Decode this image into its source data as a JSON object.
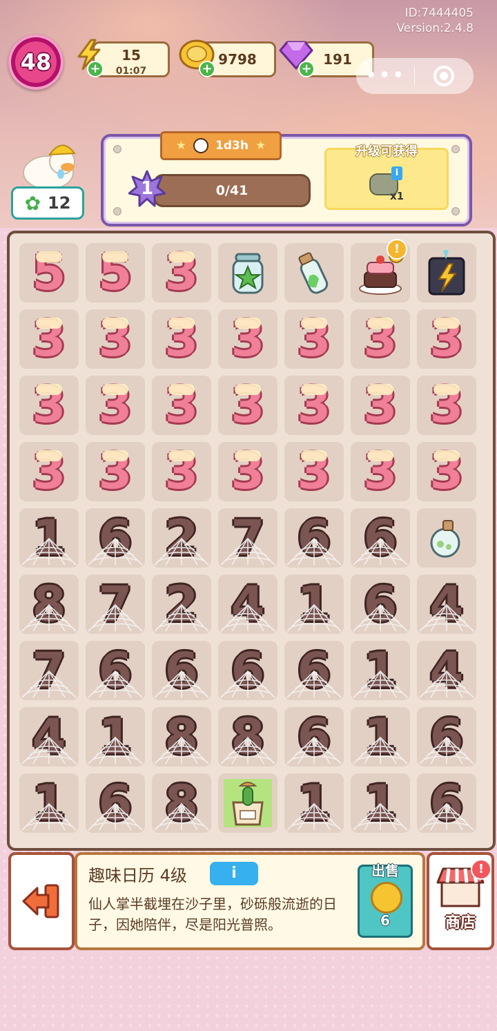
{
  "header": {
    "id_text": "ID:7444405",
    "version_text": "Version:2.4.8",
    "player_level": "48",
    "energy": {
      "value": "15",
      "timer": "01:07"
    },
    "coins": {
      "value": "9798"
    },
    "gems": {
      "value": "191"
    }
  },
  "capsule": {
    "more": "•••"
  },
  "side": {
    "stars": "12"
  },
  "event": {
    "timer": "1d3h",
    "level": "1",
    "progress_text": "0/41",
    "progress_fraction": 0.0,
    "reward_title": "升级可获得",
    "reward_count": "x1",
    "reward_info": "i"
  },
  "board": {
    "rows": [
      [
        "pink:5",
        "pink:5",
        "pink:3",
        "jar-star",
        "bottle-green",
        "cake",
        "lightning-box"
      ],
      [
        "pink:3",
        "pink:3",
        "pink:3",
        "pink:3",
        "pink:3",
        "pink:3",
        "pink:3"
      ],
      [
        "pink:3",
        "pink:3",
        "pink:3",
        "pink:3",
        "pink:3",
        "pink:3",
        "pink:3"
      ],
      [
        "pink:3",
        "pink:3",
        "pink:3",
        "pink:3",
        "pink:3",
        "pink:3",
        "pink:3"
      ],
      [
        "choc:1",
        "choc:6",
        "choc:2",
        "choc:7",
        "choc:6",
        "choc:6",
        "bottle-bulb"
      ],
      [
        "choc:8",
        "choc:7",
        "choc:2",
        "choc:4",
        "choc:1",
        "choc:6",
        "choc:4"
      ],
      [
        "choc:7",
        "choc:6",
        "choc:6",
        "choc:6",
        "choc:6",
        "choc:1",
        "choc:4"
      ],
      [
        "choc:4",
        "choc:1",
        "choc:8",
        "choc:8",
        "choc:6",
        "choc:1",
        "choc:6"
      ],
      [
        "choc:1",
        "choc:6",
        "choc:8",
        "cactus-calendar",
        "choc:1",
        "choc:1",
        "choc:6"
      ]
    ]
  },
  "selected_item": {
    "title": "趣味日历 4级",
    "info_label": "i",
    "description": "仙人掌半截埋在沙子里，砂砾般流逝的日子，因她陪伴，尽是阳光普照。",
    "sell_label": "出售",
    "sell_price": "6"
  },
  "shop": {
    "label": "商店",
    "alert": "!"
  },
  "colors": {
    "accent_purple": "#7b56a8",
    "board_border": "#6f4e3e",
    "sell_teal": "#4fc6c3"
  }
}
